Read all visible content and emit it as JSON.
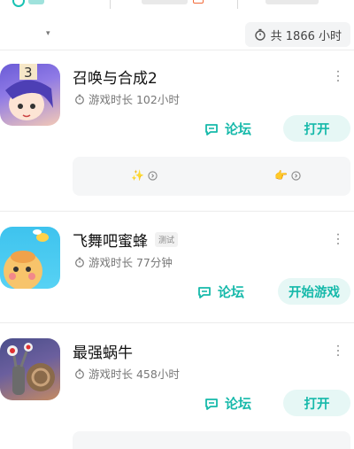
{
  "header": {
    "total_label": "共 1866 小时",
    "dropdown_caret": "▾"
  },
  "games": [
    {
      "title": "召唤与合成2",
      "playtime": "游戏时长 102小时",
      "forum_label": "论坛",
      "action_label": "打开",
      "icon": "anime-girl-game-icon",
      "news_glyphs": [
        "✨",
        "👉"
      ]
    },
    {
      "title": "飞舞吧蜜蜂",
      "tag": "测试",
      "playtime": "游戏时长 77分钟",
      "forum_label": "论坛",
      "action_label": "开始游戏",
      "icon": "bee-game-icon"
    },
    {
      "title": "最强蜗牛",
      "playtime": "游戏时长 458小时",
      "forum_label": "论坛",
      "action_label": "打开",
      "icon": "snail-game-icon"
    }
  ],
  "colors": {
    "accent": "#16b9aa",
    "accent_bg": "#e6f7f5",
    "muted": "#777777"
  }
}
